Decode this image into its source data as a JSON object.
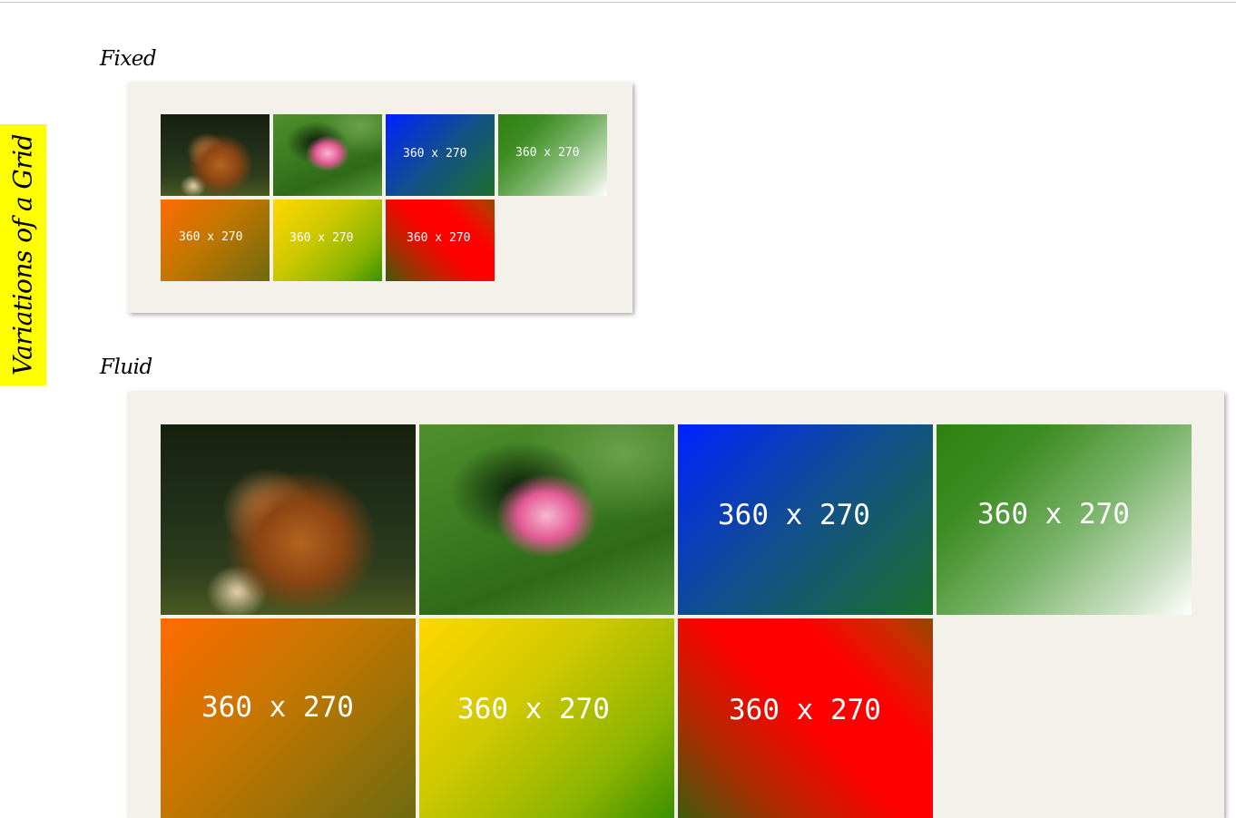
{
  "sidebar": {
    "title": "Variations of a Grid",
    "color": "#ffff00"
  },
  "sections": {
    "fixed": {
      "heading": "Fixed",
      "tiles": [
        {
          "kind": "photo",
          "subject": "horse"
        },
        {
          "kind": "photo",
          "subject": "water-lily"
        },
        {
          "kind": "placeholder",
          "label": "360 x 270",
          "color": "blue-to-green"
        },
        {
          "kind": "placeholder",
          "label": "360 x 270",
          "color": "green-to-white"
        },
        {
          "kind": "placeholder",
          "label": "360 x 270",
          "color": "orange-to-olive"
        },
        {
          "kind": "placeholder",
          "label": "360 x 270",
          "color": "yellow-to-green"
        },
        {
          "kind": "placeholder",
          "label": "360 x 270",
          "color": "red"
        }
      ]
    },
    "fluid": {
      "heading": "Fluid",
      "tiles": [
        {
          "kind": "photo",
          "subject": "horse"
        },
        {
          "kind": "photo",
          "subject": "water-lily"
        },
        {
          "kind": "placeholder",
          "label": "360 x 270",
          "color": "blue-to-green"
        },
        {
          "kind": "placeholder",
          "label": "360 x 270",
          "color": "green-to-white"
        },
        {
          "kind": "placeholder",
          "label": "360 x 270",
          "color": "orange-to-olive"
        },
        {
          "kind": "placeholder",
          "label": "360 x 270",
          "color": "yellow-to-green"
        },
        {
          "kind": "placeholder",
          "label": "360 x 270",
          "color": "red"
        }
      ]
    }
  },
  "colors": {
    "panel_background": "#f4f1ea",
    "accent_yellow": "#ffff00"
  }
}
